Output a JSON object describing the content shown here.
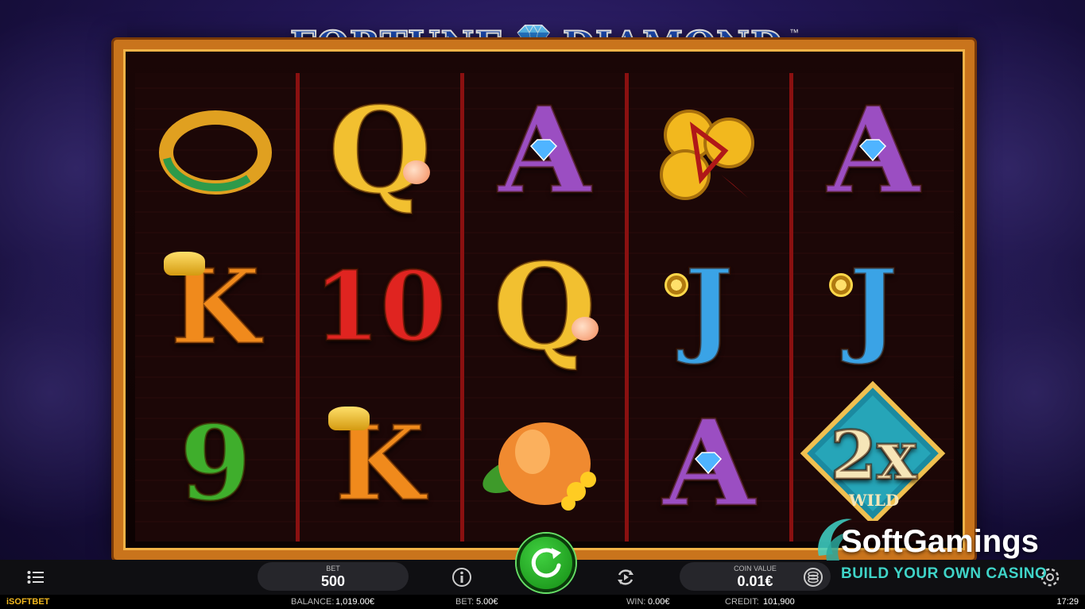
{
  "game": {
    "title_left": "FORTUNE",
    "title_right": "DIAMOND",
    "trademark": "™"
  },
  "reels": [
    [
      {
        "symbol": "jade-ring",
        "text": ""
      },
      {
        "symbol": "K",
        "text": "K",
        "badge": "gold-ingot"
      },
      {
        "symbol": "9",
        "text": "9"
      }
    ],
    [
      {
        "symbol": "Q",
        "text": "Q",
        "badge": "peach"
      },
      {
        "symbol": "10",
        "text": "10"
      },
      {
        "symbol": "K",
        "text": "K",
        "badge": "gold-ingot"
      }
    ],
    [
      {
        "symbol": "A",
        "text": "A",
        "badge": "diamond"
      },
      {
        "symbol": "Q",
        "text": "Q",
        "badge": "peach"
      },
      {
        "symbol": "peach-flower",
        "text": ""
      }
    ],
    [
      {
        "symbol": "gold-coins",
        "text": ""
      },
      {
        "symbol": "J",
        "text": "J",
        "badge": "coin"
      },
      {
        "symbol": "A",
        "text": "A",
        "badge": "diamond"
      }
    ],
    [
      {
        "symbol": "A",
        "text": "A",
        "badge": "diamond"
      },
      {
        "symbol": "J",
        "text": "J",
        "badge": "coin"
      },
      {
        "symbol": "wild-2x",
        "text": "2x",
        "sub": "WILD"
      }
    ]
  ],
  "controls": {
    "bet_label": "BET",
    "bet_value": "500",
    "coin_value_label": "COIN VALUE",
    "coin_value": "0.01€"
  },
  "status_bar": {
    "provider": "iSOFTBET",
    "balance_label": "BALANCE:",
    "balance_value": "1,019.00€",
    "bet_label": "BET:",
    "bet_value": "5.00€",
    "win_label": "WIN:",
    "win_value": "0.00€",
    "credit_label": "CREDIT:",
    "credit_value": "101,900",
    "clock": "17:29"
  },
  "watermark": {
    "name": "SoftGamings",
    "tagline": "BUILD YOUR OWN CASINO"
  },
  "colors": {
    "frame_gold": "#c9741c",
    "spin_green": "#1fae1f",
    "title_blue": "#1e4fbf",
    "brand_teal": "#3fd4c8"
  }
}
